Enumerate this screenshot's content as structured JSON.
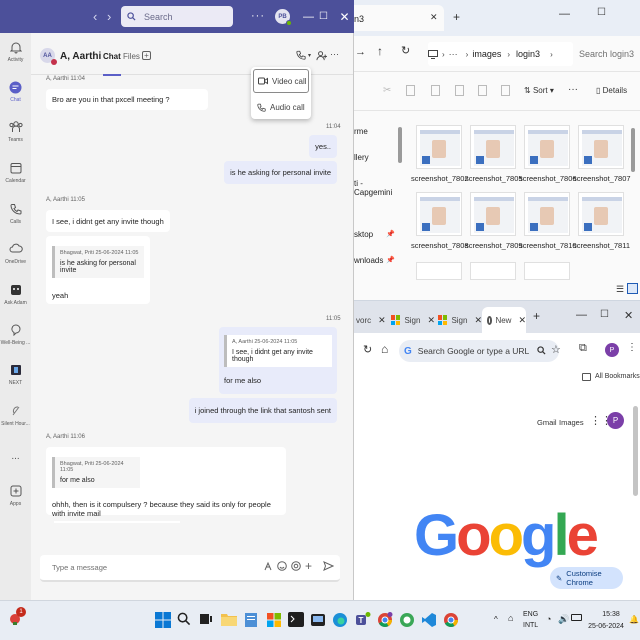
{
  "teams": {
    "search_placeholder": "Search",
    "user_initials": "PB",
    "rail": [
      {
        "label": "Activity",
        "icon": "bell-icon"
      },
      {
        "label": "Chat",
        "icon": "chat-icon"
      },
      {
        "label": "Teams",
        "icon": "teams-icon"
      },
      {
        "label": "Calendar",
        "icon": "calendar-icon"
      },
      {
        "label": "Calls",
        "icon": "phone-icon"
      },
      {
        "label": "OneDrive",
        "icon": "cloud-icon"
      },
      {
        "label": "Ask Adam",
        "icon": "bot-icon"
      },
      {
        "label": "Well-Being ...",
        "icon": "wellbeing-icon"
      },
      {
        "label": "NEXT",
        "icon": "next-icon"
      },
      {
        "label": "Silent Hour...",
        "icon": "silent-icon"
      },
      {
        "label": "...",
        "icon": "more-icon"
      },
      {
        "label": "Apps",
        "icon": "apps-icon"
      }
    ],
    "chat_header": {
      "initials": "AA",
      "name": "A, Aarthi",
      "tab_chat": "Chat",
      "tab_files": "Files",
      "tab_add": "+"
    },
    "call_menu": {
      "video": "Video call",
      "audio": "Audio call"
    },
    "messages": {
      "m1_meta": "A, Aarthi  11:04",
      "m1_text": "Bro are you in that pxcell meeting ?",
      "m2_time": "11:04",
      "m2_text": "yes..",
      "m3_text": "is he asking for personal invite",
      "m4_meta": "A, Aarthi  11:05",
      "m4_text": "I see, i didnt get any invite though",
      "m5_quote_meta": "Bhagwat, Priti  25-06-2024 11:05",
      "m5_quote_text": "is he asking for personal invite",
      "m5_text": "yeah",
      "m6_time": "11:05",
      "m6_quote_meta": "A, Aarthi  25-06-2024 11:05",
      "m6_quote_text": "I see, i didnt get any invite though",
      "m6_text": "for me also",
      "m7_text": "i joined through the link that santosh sent",
      "m8_meta": "A, Aarthi  11:06",
      "m8_quote_meta": "Bhagwat, Priti  25-06-2024 11:05",
      "m8_quote_text": "for me also",
      "m8_text": "ohhh, then is it compulsery ? because they said its only for people with invite mail"
    },
    "compose_placeholder": "Type a message"
  },
  "explorer": {
    "tab_title": "n3",
    "tab_add": "+",
    "breadcrumb": [
      "images",
      "login3"
    ],
    "search_placeholder": "Search login3",
    "sort_label": "Sort",
    "details_label": "Details",
    "side_items": [
      "rme",
      "llery",
      "ti - Capgemini",
      "sktop",
      "wnloads"
    ],
    "files": [
      "screenshot_7802",
      "screenshot_7805",
      "screenshot_7806",
      "screenshot_7807",
      "screenshot_7808",
      "screenshot_7809",
      "screenshot_7810",
      "screenshot_7811"
    ]
  },
  "chrome": {
    "tabs": [
      {
        "label": "vorc"
      },
      {
        "label": "Sign"
      },
      {
        "label": "Sign"
      },
      {
        "label": "New"
      }
    ],
    "tab_add": "+",
    "omnibox_placeholder": "Search Google or type a URL",
    "profile_initial": "P",
    "all_bookmarks": "All Bookmarks",
    "gmail": "Gmail",
    "images": "Images",
    "logo": "Google",
    "customise": "Customise Chrome"
  },
  "taskbar": {
    "notification_count": "1",
    "lang_1": "ENG",
    "lang_2": "INTL",
    "time": "15:38",
    "date": "25-06-2024"
  },
  "colors": {
    "teams_purple": "#4c509a",
    "teams_accent": "#5b5fc7",
    "chrome_tabbar": "#dfe3eb"
  }
}
